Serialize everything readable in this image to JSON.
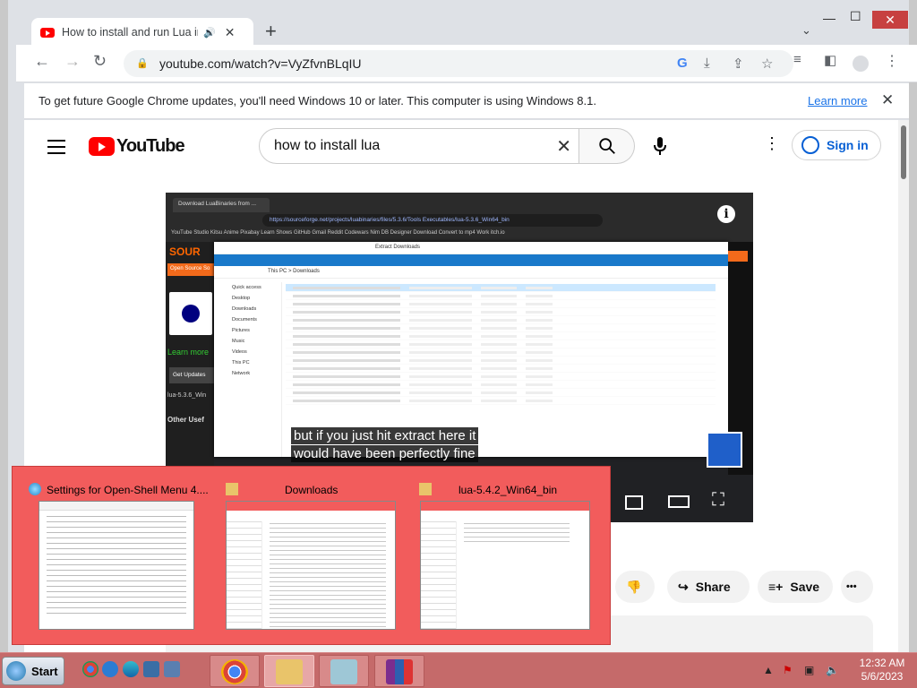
{
  "browser": {
    "tab_title": "How to install and run Lua in",
    "tab_close": "✕",
    "new_tab": "+",
    "url": "youtube.com/watch?v=VyZfvnBLqIU"
  },
  "infobar": {
    "message": "To get future Google Chrome updates, you'll need Windows 10 or later. This computer is using Windows 8.1.",
    "learn_more": "Learn more",
    "close": "✕"
  },
  "youtube": {
    "logo_text": "YouTube",
    "search_value": "how to install lua",
    "sign_in": "Sign in",
    "video": {
      "tab_text": "Download LuaBinaries from ...",
      "url_text": "https://sourceforge.net/projects/luabinaries/files/5.3.6/Tools Executables/lua-5.3.6_Win64_bin",
      "bookmarks": "YouTube  Studio  Kitsu  Anime  Pixabay  Learn  Shows  GitHub  Gmail  Reddit  Codewars  Nim  DB Designer  Download  Convert to mp4  Work  itch.io",
      "site_brand": "SOUR",
      "site_orange": "Open Source So",
      "site_green": "Learn more",
      "site_getupdates": "Get Updates",
      "site_file": "lua-5.3.6_Win",
      "site_other": "Other Usef",
      "explorer_tabs": "Extract     Downloads",
      "explorer_path": "This PC  >  Downloads",
      "explorer_nav": [
        "Quick access",
        "Desktop",
        "Downloads",
        "Documents",
        "Pictures",
        "Music",
        "Videos",
        "This PC",
        "Network"
      ],
      "caption_line1": "but if you just hit extract here it",
      "caption_line2": "would have been perfectly fine",
      "info_icon": "i"
    },
    "actions": {
      "share": "Share",
      "save": "Save",
      "more": "•••"
    }
  },
  "popup": {
    "items": [
      {
        "title": "Settings for Open-Shell Menu 4...."
      },
      {
        "title": "Downloads"
      },
      {
        "title": "lua-5.4.2_Win64_bin"
      }
    ]
  },
  "taskbar": {
    "start_label": "Start",
    "time": "12:32 AM",
    "date": "5/6/2023"
  },
  "colors": {
    "youtube_red": "#ff0000",
    "popup_bg": "#f25c5c",
    "taskbar_bg": "#c56a6a",
    "link_blue": "#1a73e8"
  },
  "icons": [
    "back-arrow-icon",
    "forward-arrow-icon",
    "reload-icon",
    "lock-icon",
    "google-icon",
    "download-icon",
    "share-page-icon",
    "bookmark-star-icon",
    "media-icon",
    "side-panel-icon",
    "profile-icon",
    "menu-dots-icon",
    "hamburger-icon",
    "search-icon",
    "microphone-icon",
    "clear-icon",
    "dislike-icon",
    "share-icon",
    "save-icon"
  ]
}
